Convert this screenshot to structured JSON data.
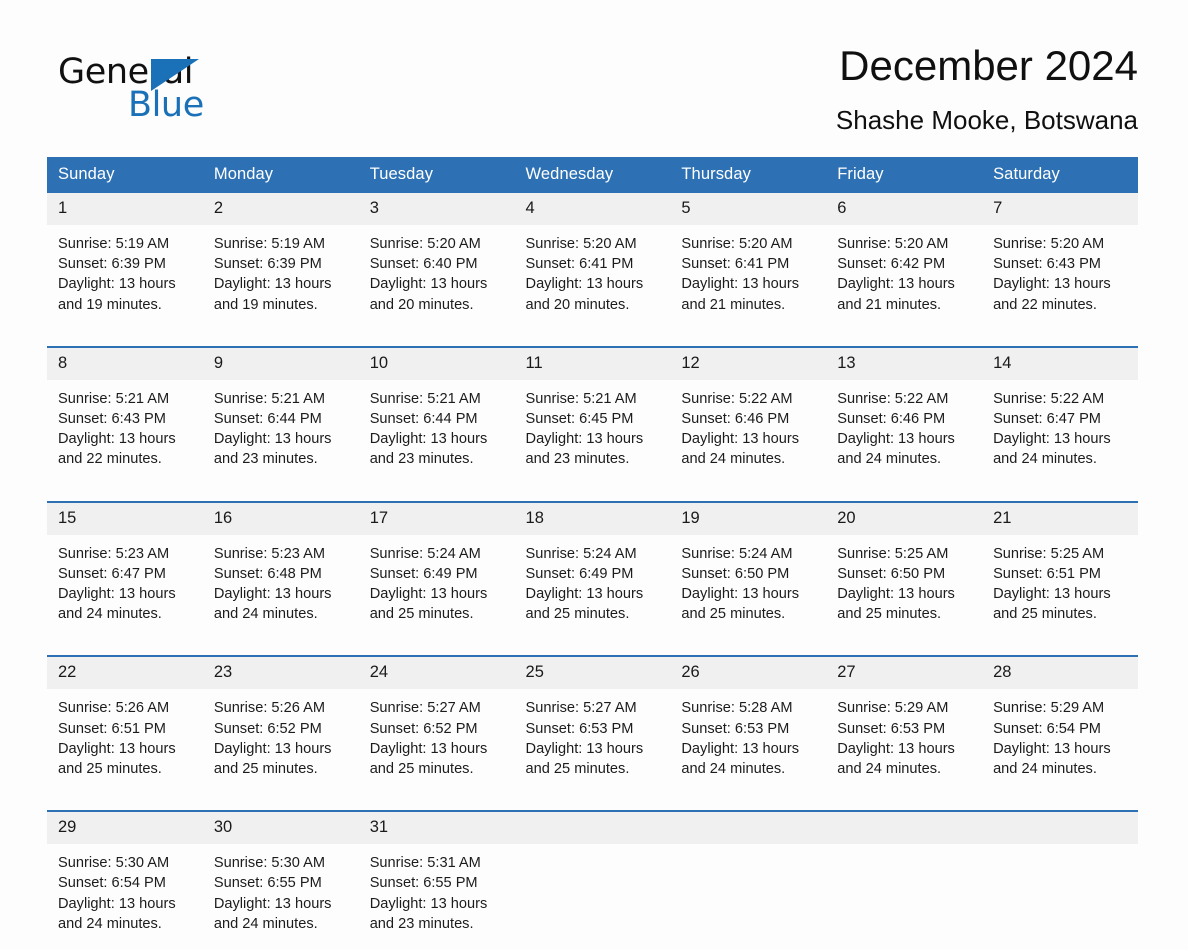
{
  "brand": {
    "name_top": "General",
    "name_bottom": "Blue",
    "accent_color": "#1b71b8"
  },
  "header": {
    "title": "December 2024",
    "subtitle": "Shashe Mooke, Botswana"
  },
  "calendar": {
    "header_bg": "#2d71b4",
    "daynum_bg": "#f0f0f0",
    "weekday_names": [
      "Sunday",
      "Monday",
      "Tuesday",
      "Wednesday",
      "Thursday",
      "Friday",
      "Saturday"
    ],
    "weeks": [
      [
        {
          "day": "1",
          "sunrise": "Sunrise: 5:19 AM",
          "sunset": "Sunset: 6:39 PM",
          "daylight_line1": "Daylight: 13 hours",
          "daylight_line2": "and 19 minutes."
        },
        {
          "day": "2",
          "sunrise": "Sunrise: 5:19 AM",
          "sunset": "Sunset: 6:39 PM",
          "daylight_line1": "Daylight: 13 hours",
          "daylight_line2": "and 19 minutes."
        },
        {
          "day": "3",
          "sunrise": "Sunrise: 5:20 AM",
          "sunset": "Sunset: 6:40 PM",
          "daylight_line1": "Daylight: 13 hours",
          "daylight_line2": "and 20 minutes."
        },
        {
          "day": "4",
          "sunrise": "Sunrise: 5:20 AM",
          "sunset": "Sunset: 6:41 PM",
          "daylight_line1": "Daylight: 13 hours",
          "daylight_line2": "and 20 minutes."
        },
        {
          "day": "5",
          "sunrise": "Sunrise: 5:20 AM",
          "sunset": "Sunset: 6:41 PM",
          "daylight_line1": "Daylight: 13 hours",
          "daylight_line2": "and 21 minutes."
        },
        {
          "day": "6",
          "sunrise": "Sunrise: 5:20 AM",
          "sunset": "Sunset: 6:42 PM",
          "daylight_line1": "Daylight: 13 hours",
          "daylight_line2": "and 21 minutes."
        },
        {
          "day": "7",
          "sunrise": "Sunrise: 5:20 AM",
          "sunset": "Sunset: 6:43 PM",
          "daylight_line1": "Daylight: 13 hours",
          "daylight_line2": "and 22 minutes."
        }
      ],
      [
        {
          "day": "8",
          "sunrise": "Sunrise: 5:21 AM",
          "sunset": "Sunset: 6:43 PM",
          "daylight_line1": "Daylight: 13 hours",
          "daylight_line2": "and 22 minutes."
        },
        {
          "day": "9",
          "sunrise": "Sunrise: 5:21 AM",
          "sunset": "Sunset: 6:44 PM",
          "daylight_line1": "Daylight: 13 hours",
          "daylight_line2": "and 23 minutes."
        },
        {
          "day": "10",
          "sunrise": "Sunrise: 5:21 AM",
          "sunset": "Sunset: 6:44 PM",
          "daylight_line1": "Daylight: 13 hours",
          "daylight_line2": "and 23 minutes."
        },
        {
          "day": "11",
          "sunrise": "Sunrise: 5:21 AM",
          "sunset": "Sunset: 6:45 PM",
          "daylight_line1": "Daylight: 13 hours",
          "daylight_line2": "and 23 minutes."
        },
        {
          "day": "12",
          "sunrise": "Sunrise: 5:22 AM",
          "sunset": "Sunset: 6:46 PM",
          "daylight_line1": "Daylight: 13 hours",
          "daylight_line2": "and 24 minutes."
        },
        {
          "day": "13",
          "sunrise": "Sunrise: 5:22 AM",
          "sunset": "Sunset: 6:46 PM",
          "daylight_line1": "Daylight: 13 hours",
          "daylight_line2": "and 24 minutes."
        },
        {
          "day": "14",
          "sunrise": "Sunrise: 5:22 AM",
          "sunset": "Sunset: 6:47 PM",
          "daylight_line1": "Daylight: 13 hours",
          "daylight_line2": "and 24 minutes."
        }
      ],
      [
        {
          "day": "15",
          "sunrise": "Sunrise: 5:23 AM",
          "sunset": "Sunset: 6:47 PM",
          "daylight_line1": "Daylight: 13 hours",
          "daylight_line2": "and 24 minutes."
        },
        {
          "day": "16",
          "sunrise": "Sunrise: 5:23 AM",
          "sunset": "Sunset: 6:48 PM",
          "daylight_line1": "Daylight: 13 hours",
          "daylight_line2": "and 24 minutes."
        },
        {
          "day": "17",
          "sunrise": "Sunrise: 5:24 AM",
          "sunset": "Sunset: 6:49 PM",
          "daylight_line1": "Daylight: 13 hours",
          "daylight_line2": "and 25 minutes."
        },
        {
          "day": "18",
          "sunrise": "Sunrise: 5:24 AM",
          "sunset": "Sunset: 6:49 PM",
          "daylight_line1": "Daylight: 13 hours",
          "daylight_line2": "and 25 minutes."
        },
        {
          "day": "19",
          "sunrise": "Sunrise: 5:24 AM",
          "sunset": "Sunset: 6:50 PM",
          "daylight_line1": "Daylight: 13 hours",
          "daylight_line2": "and 25 minutes."
        },
        {
          "day": "20",
          "sunrise": "Sunrise: 5:25 AM",
          "sunset": "Sunset: 6:50 PM",
          "daylight_line1": "Daylight: 13 hours",
          "daylight_line2": "and 25 minutes."
        },
        {
          "day": "21",
          "sunrise": "Sunrise: 5:25 AM",
          "sunset": "Sunset: 6:51 PM",
          "daylight_line1": "Daylight: 13 hours",
          "daylight_line2": "and 25 minutes."
        }
      ],
      [
        {
          "day": "22",
          "sunrise": "Sunrise: 5:26 AM",
          "sunset": "Sunset: 6:51 PM",
          "daylight_line1": "Daylight: 13 hours",
          "daylight_line2": "and 25 minutes."
        },
        {
          "day": "23",
          "sunrise": "Sunrise: 5:26 AM",
          "sunset": "Sunset: 6:52 PM",
          "daylight_line1": "Daylight: 13 hours",
          "daylight_line2": "and 25 minutes."
        },
        {
          "day": "24",
          "sunrise": "Sunrise: 5:27 AM",
          "sunset": "Sunset: 6:52 PM",
          "daylight_line1": "Daylight: 13 hours",
          "daylight_line2": "and 25 minutes."
        },
        {
          "day": "25",
          "sunrise": "Sunrise: 5:27 AM",
          "sunset": "Sunset: 6:53 PM",
          "daylight_line1": "Daylight: 13 hours",
          "daylight_line2": "and 25 minutes."
        },
        {
          "day": "26",
          "sunrise": "Sunrise: 5:28 AM",
          "sunset": "Sunset: 6:53 PM",
          "daylight_line1": "Daylight: 13 hours",
          "daylight_line2": "and 24 minutes."
        },
        {
          "day": "27",
          "sunrise": "Sunrise: 5:29 AM",
          "sunset": "Sunset: 6:53 PM",
          "daylight_line1": "Daylight: 13 hours",
          "daylight_line2": "and 24 minutes."
        },
        {
          "day": "28",
          "sunrise": "Sunrise: 5:29 AM",
          "sunset": "Sunset: 6:54 PM",
          "daylight_line1": "Daylight: 13 hours",
          "daylight_line2": "and 24 minutes."
        }
      ],
      [
        {
          "day": "29",
          "sunrise": "Sunrise: 5:30 AM",
          "sunset": "Sunset: 6:54 PM",
          "daylight_line1": "Daylight: 13 hours",
          "daylight_line2": "and 24 minutes."
        },
        {
          "day": "30",
          "sunrise": "Sunrise: 5:30 AM",
          "sunset": "Sunset: 6:55 PM",
          "daylight_line1": "Daylight: 13 hours",
          "daylight_line2": "and 24 minutes."
        },
        {
          "day": "31",
          "sunrise": "Sunrise: 5:31 AM",
          "sunset": "Sunset: 6:55 PM",
          "daylight_line1": "Daylight: 13 hours",
          "daylight_line2": "and 23 minutes."
        },
        {
          "day": "",
          "sunrise": "",
          "sunset": "",
          "daylight_line1": "",
          "daylight_line2": ""
        },
        {
          "day": "",
          "sunrise": "",
          "sunset": "",
          "daylight_line1": "",
          "daylight_line2": ""
        },
        {
          "day": "",
          "sunrise": "",
          "sunset": "",
          "daylight_line1": "",
          "daylight_line2": ""
        },
        {
          "day": "",
          "sunrise": "",
          "sunset": "",
          "daylight_line1": "",
          "daylight_line2": ""
        }
      ]
    ]
  }
}
